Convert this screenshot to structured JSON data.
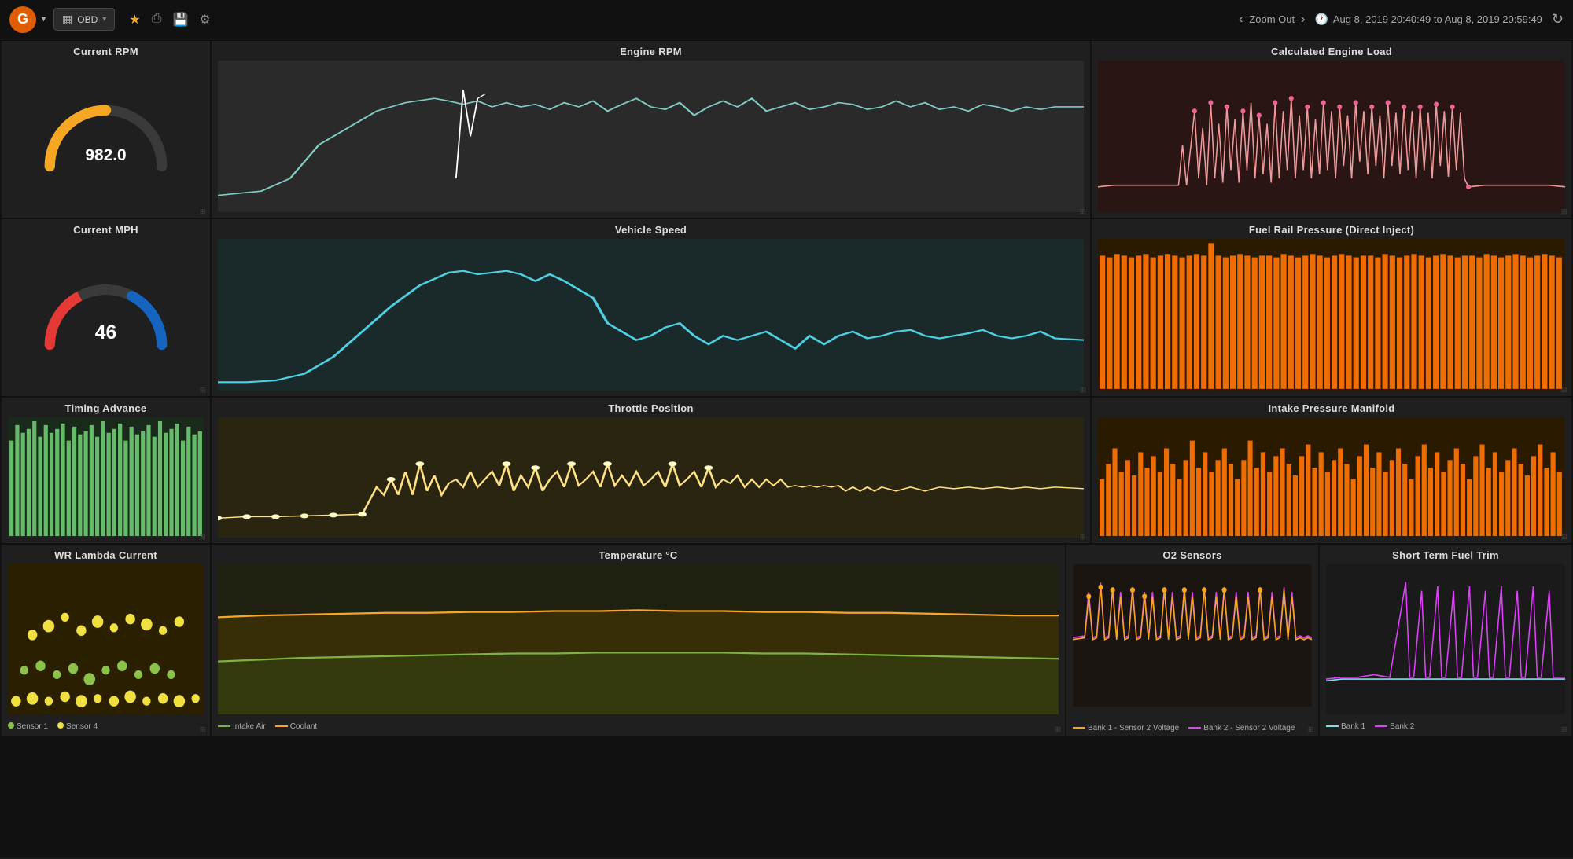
{
  "nav": {
    "logo": "G",
    "obd_label": "OBD",
    "zoom_out": "Zoom Out",
    "time_range": "Aug 8, 2019 20:40:49 to Aug 8, 2019 20:59:49"
  },
  "panels": {
    "current_rpm": {
      "title": "Current RPM",
      "value": "982.0"
    },
    "engine_rpm": {
      "title": "Engine RPM"
    },
    "calc_engine_load": {
      "title": "Calculated Engine Load"
    },
    "current_mph": {
      "title": "Current MPH",
      "value": "46"
    },
    "vehicle_speed": {
      "title": "Vehicle Speed"
    },
    "fuel_rail": {
      "title": "Fuel Rail Pressure (Direct Inject)"
    },
    "timing_advance": {
      "title": "Timing Advance"
    },
    "throttle_position": {
      "title": "Throttle Position"
    },
    "intake_manifold": {
      "title": "Intake Pressure Manifold"
    },
    "wr_lambda": {
      "title": "WR Lambda Current",
      "legend": [
        {
          "label": "Sensor 1",
          "color": "#8bc34a"
        },
        {
          "label": "Sensor 4",
          "color": "#f0e040"
        }
      ]
    },
    "temperature": {
      "title": "Temperature °C",
      "legend": [
        {
          "label": "Intake Air",
          "color": "#7cb342"
        },
        {
          "label": "Coolant",
          "color": "#f5a623"
        }
      ]
    },
    "o2_sensors": {
      "title": "O2 Sensors",
      "legend": [
        {
          "label": "Bank 1 - Sensor 2 Voltage",
          "color": "#f5a623"
        },
        {
          "label": "Bank 2 - Sensor 2 Voltage",
          "color": "#e040fb"
        }
      ]
    },
    "short_term_fuel": {
      "title": "Short Term Fuel Trim",
      "legend": [
        {
          "label": "Bank 1",
          "color": "#80deea"
        },
        {
          "label": "Bank 2",
          "color": "#e040fb"
        }
      ]
    }
  },
  "colors": {
    "accent_orange": "#e05c00",
    "rpm_gauge_yellow": "#f5a623",
    "rpm_gauge_dark": "#555",
    "mph_gauge_red": "#e53935",
    "mph_gauge_blue": "#1565c0",
    "engine_rpm_line": "#80cbc4",
    "vehicle_speed_line": "#4dd0e1",
    "calc_load_line": "#ef9a9a",
    "calc_load_dot": "#f06292",
    "fuel_rail_bar": "#ef6c00",
    "timing_bar": "#66bb6a",
    "throttle_line": "#ffe082",
    "throttle_dot": "#fff9c4",
    "intake_bar": "#ef6c00",
    "temp_intake": "#7cb342",
    "temp_coolant": "#f5a623",
    "o2_bank1": "#f5a623",
    "o2_bank2": "#e040fb",
    "fuel_bank1": "#80deea",
    "fuel_bank2": "#e040fb"
  }
}
